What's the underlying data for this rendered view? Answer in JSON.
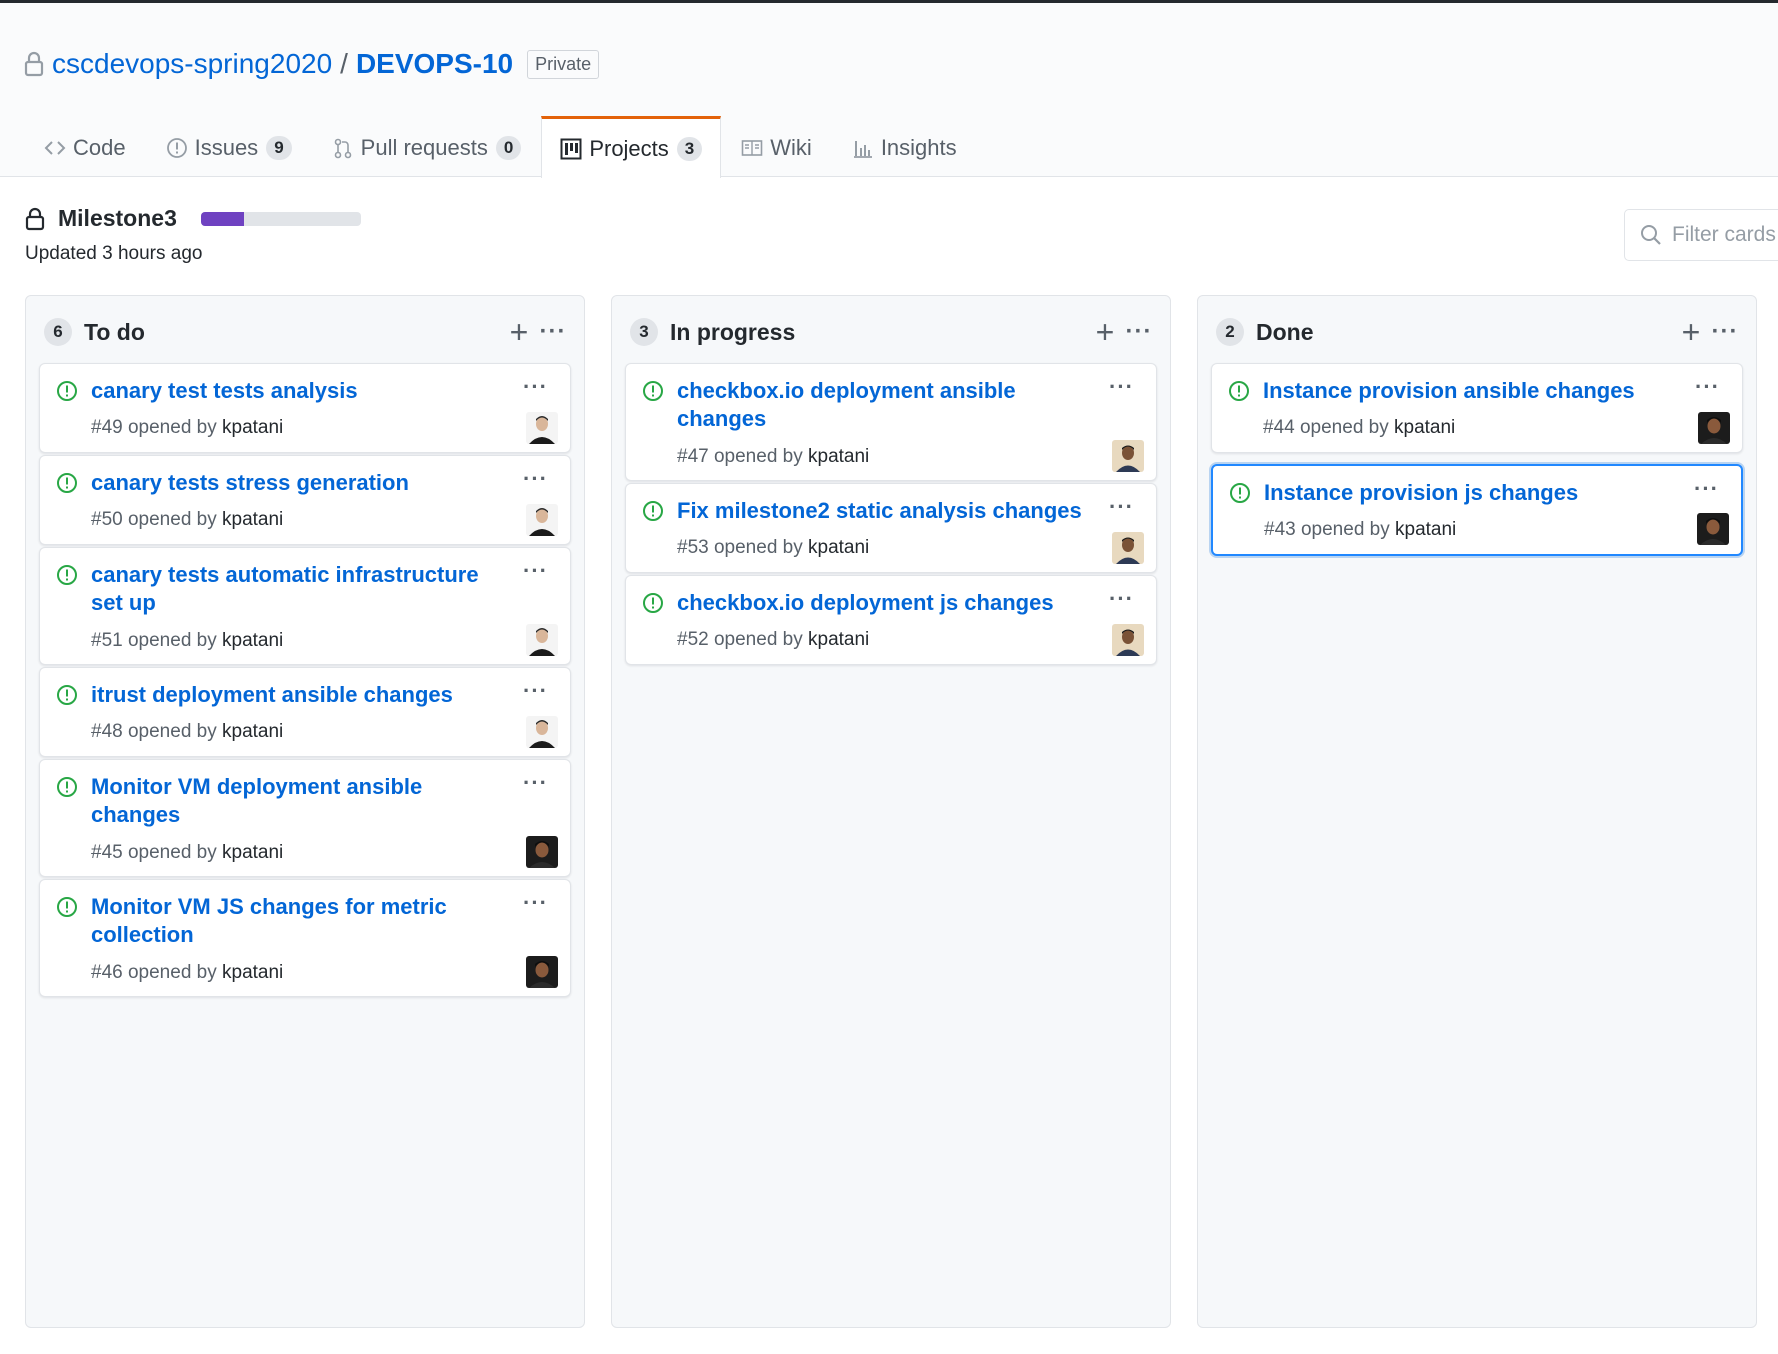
{
  "repo": {
    "owner": "cscdevops-spring2020",
    "separator": "/",
    "name": "DEVOPS-10",
    "visibility": "Private"
  },
  "tabs": [
    {
      "label": "Code",
      "icon": "code-icon",
      "count": null
    },
    {
      "label": "Issues",
      "icon": "issue-icon",
      "count": "9"
    },
    {
      "label": "Pull requests",
      "icon": "pull-request-icon",
      "count": "0"
    },
    {
      "label": "Projects",
      "icon": "project-icon",
      "count": "3",
      "active": true
    },
    {
      "label": "Wiki",
      "icon": "book-icon",
      "count": null
    },
    {
      "label": "Insights",
      "icon": "graph-icon",
      "count": null
    }
  ],
  "project": {
    "name": "Milestone3",
    "updated": "Updated 3 hours ago",
    "progress_fraction": 0.27,
    "progress_color": "#6f42c1",
    "filter_placeholder": "Filter cards"
  },
  "columns": [
    {
      "name": "To do",
      "count": "6",
      "cards": [
        {
          "title_lines": [
            "canary test tests analysis"
          ],
          "meta_number": "#49 opened by",
          "author": "kpatani",
          "avatar": "light"
        },
        {
          "title_lines": [
            "canary tests stress generation"
          ],
          "meta_number": "#50 opened by",
          "author": "kpatani",
          "avatar": "light"
        },
        {
          "title_lines": [
            "canary tests automatic infrastructure",
            "set up"
          ],
          "meta_number": "#51 opened by",
          "author": "kpatani",
          "avatar": "light"
        },
        {
          "title_lines": [
            "itrust deployment ansible changes"
          ],
          "meta_number": "#48 opened by",
          "author": "kpatani",
          "avatar": "light"
        },
        {
          "title_lines": [
            "Monitor VM deployment ansible",
            "changes"
          ],
          "meta_number": "#45 opened by",
          "author": "kpatani",
          "avatar": "dark"
        },
        {
          "title_lines": [
            "Monitor VM JS changes for metric",
            "collection"
          ],
          "meta_number": "#46 opened by",
          "author": "kpatani",
          "avatar": "dark"
        }
      ]
    },
    {
      "name": "In progress",
      "count": "3",
      "cards": [
        {
          "title_lines": [
            "checkbox.io deployment ansible",
            "changes"
          ],
          "meta_number": "#47 opened by",
          "author": "kpatani",
          "avatar": "beige"
        },
        {
          "title_lines": [
            "Fix milestone2 static analysis changes"
          ],
          "meta_number": "#53 opened by",
          "author": "kpatani",
          "avatar": "beige"
        },
        {
          "title_lines": [
            "checkbox.io deployment js changes"
          ],
          "meta_number": "#52 opened by",
          "author": "kpatani",
          "avatar": "beige"
        }
      ]
    },
    {
      "name": "Done",
      "count": "2",
      "cards": [
        {
          "title_lines": [
            "Instance provision ansible changes"
          ],
          "meta_number": "#44 opened by",
          "author": "kpatani",
          "avatar": "dark"
        },
        {
          "title_lines": [
            "Instance provision js changes"
          ],
          "meta_number": "#43 opened by",
          "author": "kpatani",
          "avatar": "dark",
          "selected": true
        }
      ]
    }
  ],
  "icons": {
    "add": "+",
    "menu": "···"
  },
  "colors": {
    "link": "#0366d6",
    "open_issue": "#28a745",
    "tab_active_border": "#e36209",
    "selected_card_border": "#2188ff"
  }
}
